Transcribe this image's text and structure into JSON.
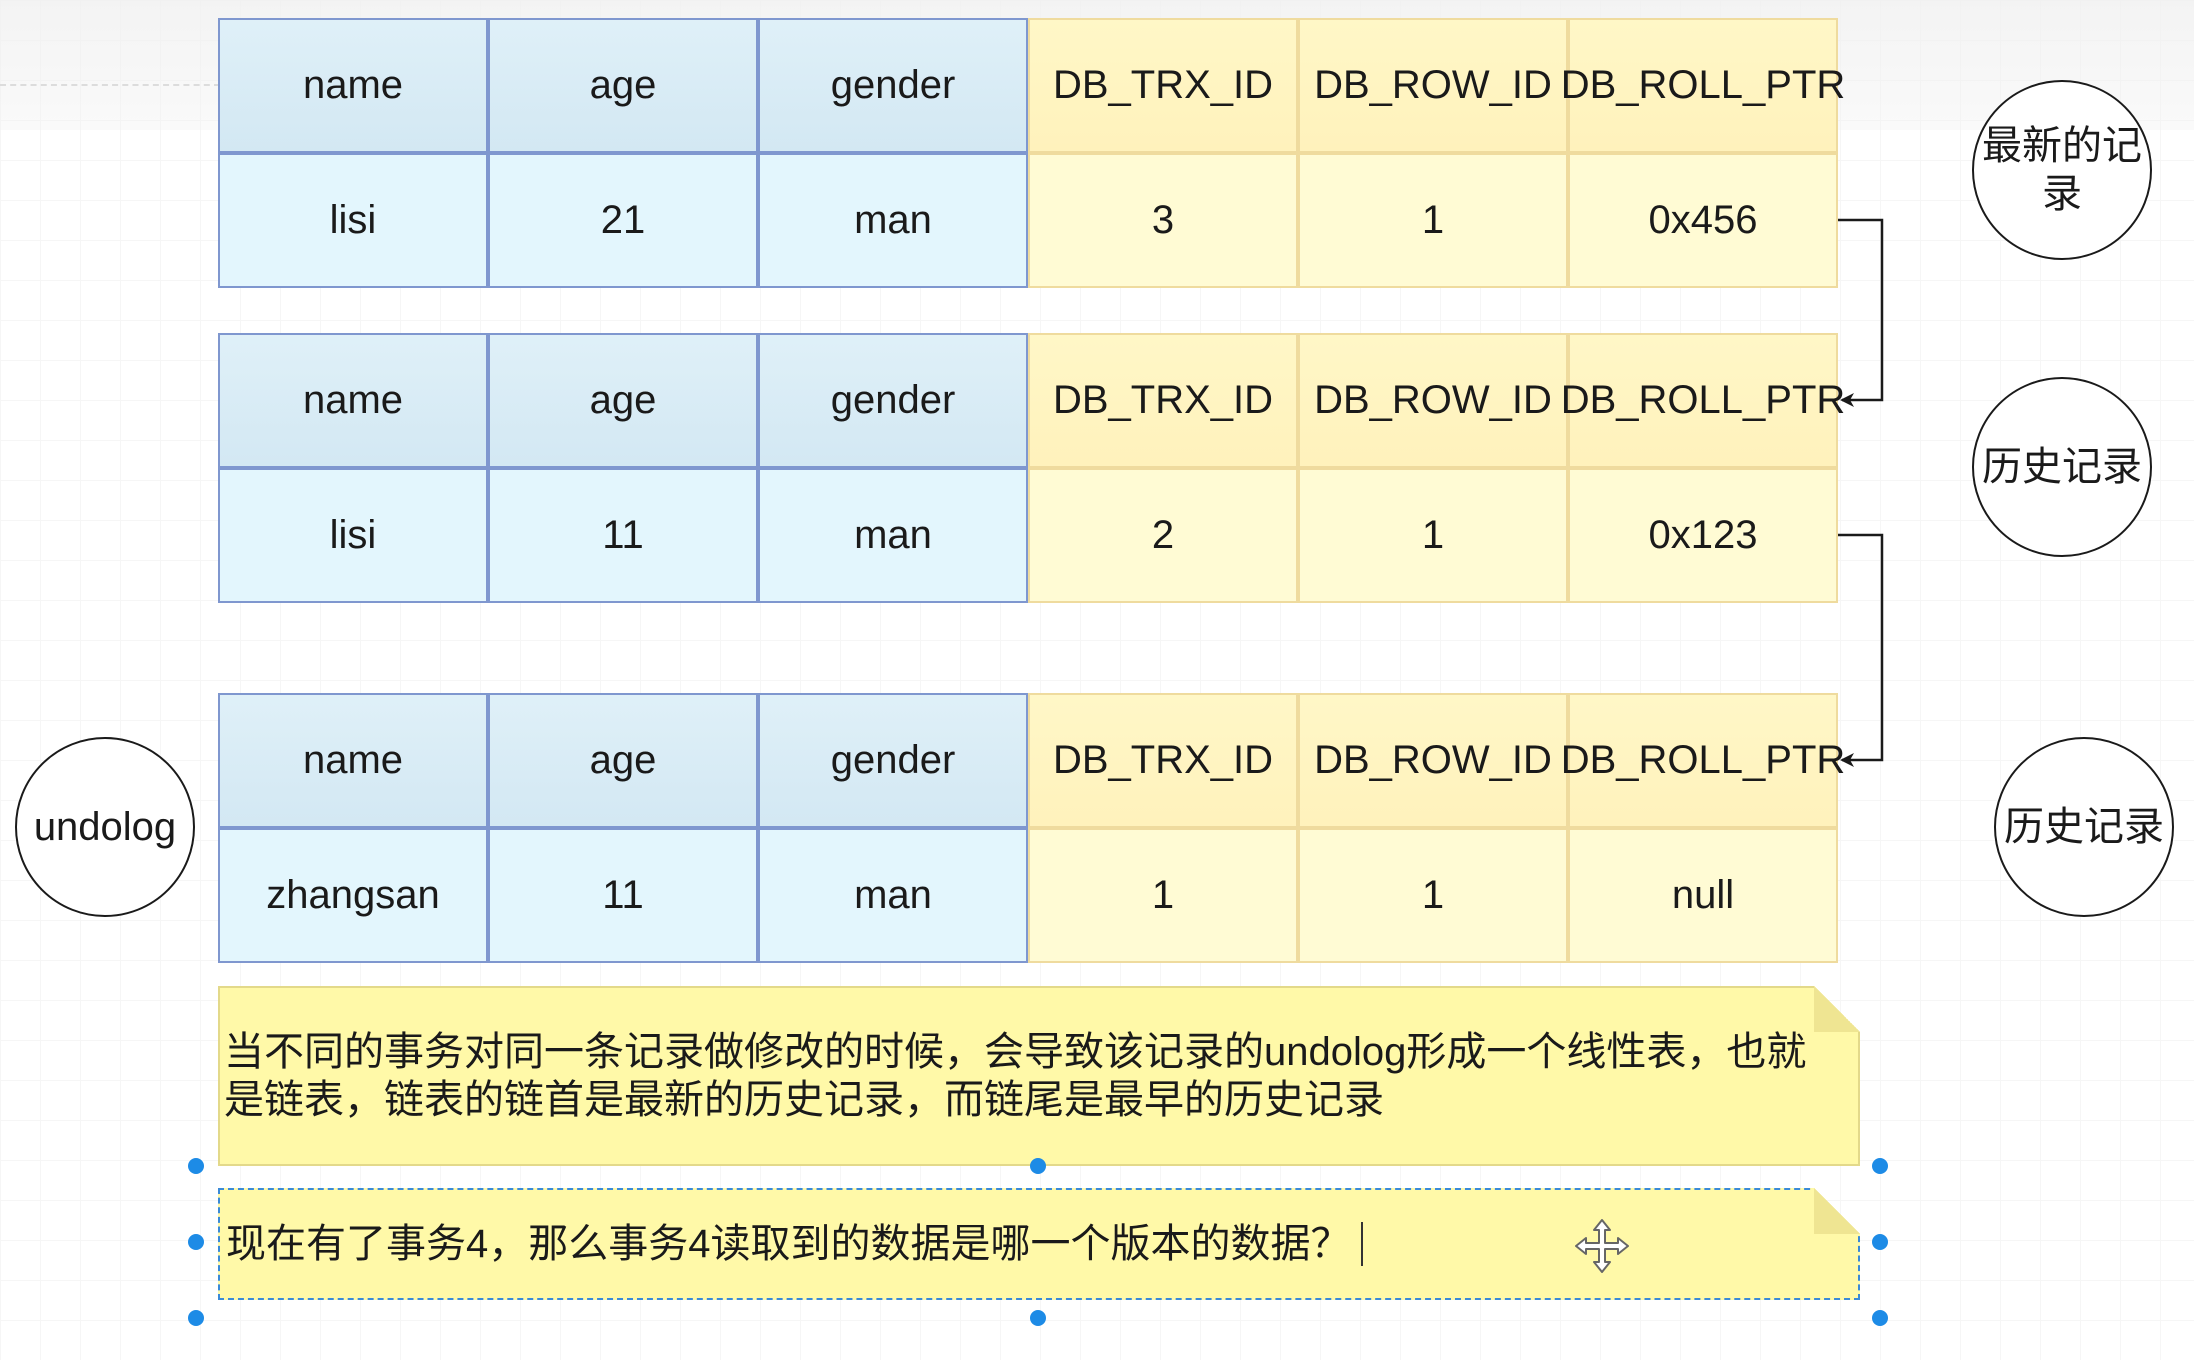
{
  "records": [
    {
      "id": "latest",
      "headers": [
        "name",
        "age",
        "gender",
        "DB_TRX_ID",
        "DB_ROW_ID",
        "DB_ROLL_PTR"
      ],
      "values": [
        "lisi",
        "21",
        "man",
        "3",
        "1",
        "0x456"
      ],
      "side_label": "最新的记录"
    },
    {
      "id": "history-1",
      "headers": [
        "name",
        "age",
        "gender",
        "DB_TRX_ID",
        "DB_ROW_ID",
        "DB_ROLL_PTR"
      ],
      "values": [
        "lisi",
        "11",
        "man",
        "2",
        "1",
        "0x123"
      ],
      "side_label": "历史记录"
    },
    {
      "id": "history-2",
      "headers": [
        "name",
        "age",
        "gender",
        "DB_TRX_ID",
        "DB_ROW_ID",
        "DB_ROLL_PTR"
      ],
      "values": [
        "zhangsan",
        "11",
        "man",
        "1",
        "1",
        "null"
      ],
      "side_label": "历史记录"
    }
  ],
  "undolog_label": "undolog",
  "note_text": "当不同的事务对同一条记录做修改的时候，会导致该记录的undolog形成一个线性表，也就是链表，链表的链首是最新的历史记录，而链尾是最早的历史记录",
  "question_text": "现在有了事务4，那么事务4读取到的数据是哪一个版本的数据？",
  "colors": {
    "user_columns": "#e3f6fd",
    "user_border": "#7f97cf",
    "hidden_columns": "#fffbd4",
    "hidden_border": "#efdb9e",
    "note": "#fff9a8",
    "selection": "#1d8be6"
  },
  "icons": {
    "move": "move-icon"
  }
}
